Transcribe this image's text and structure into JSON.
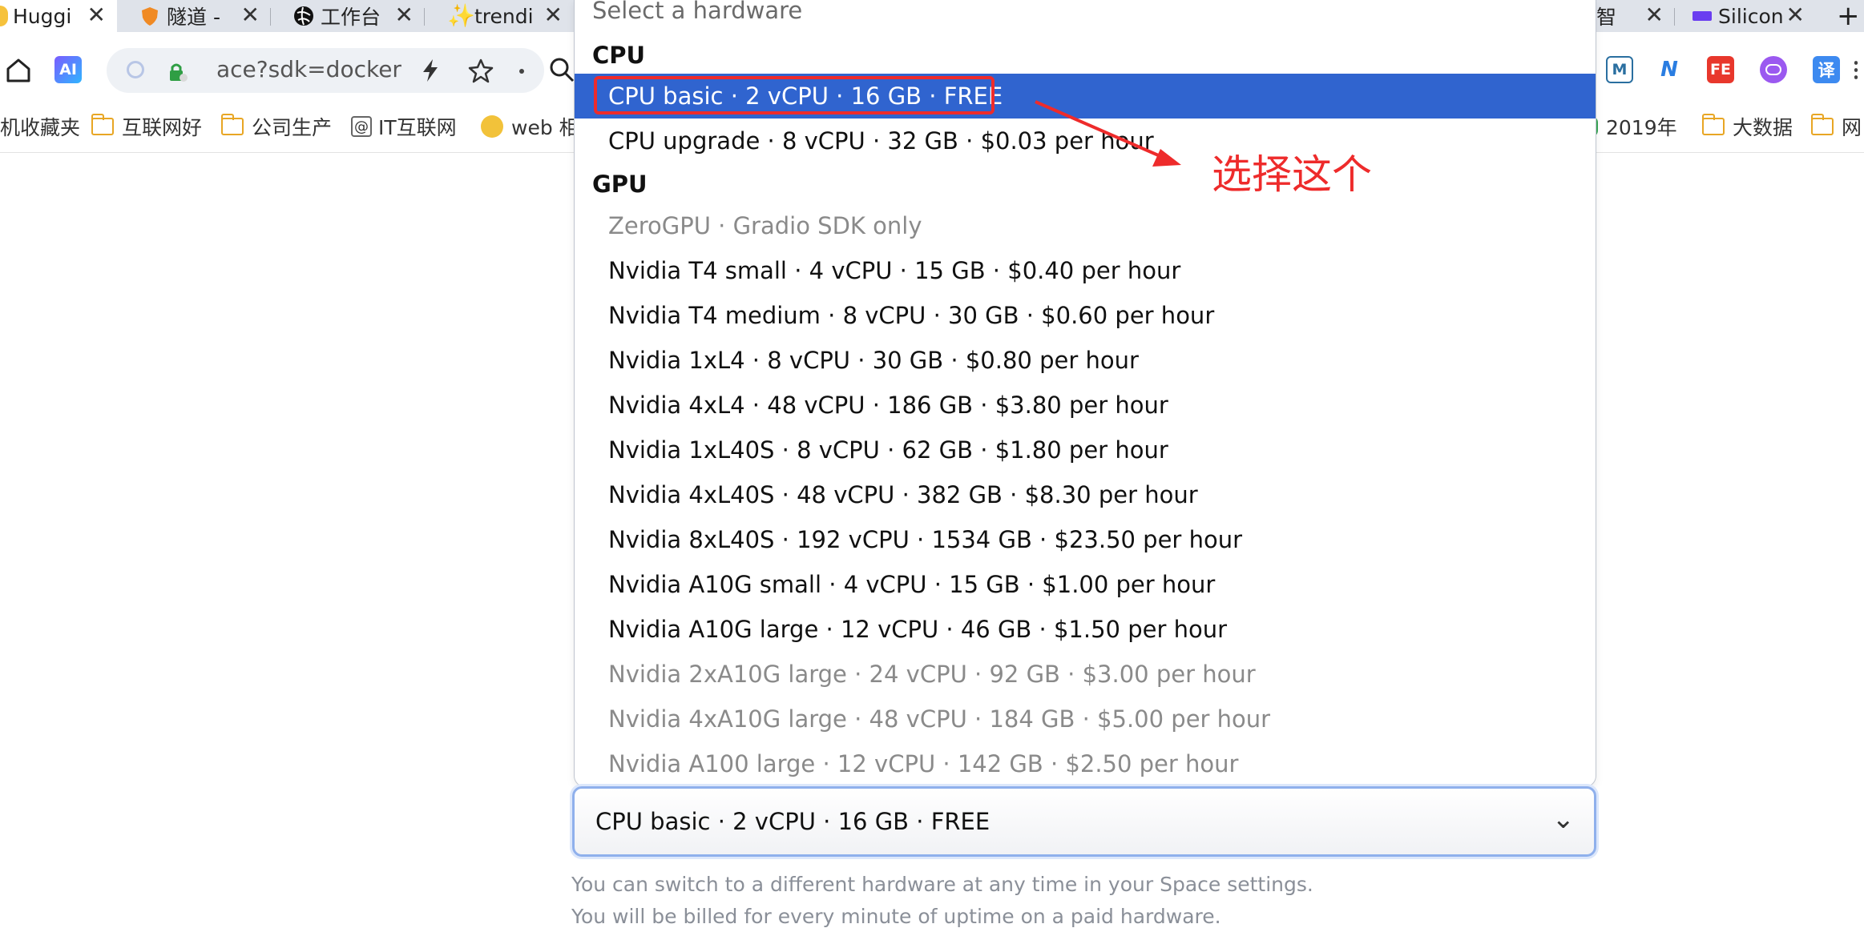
{
  "tabs": [
    {
      "label": "Huggi",
      "active": true
    },
    {
      "label": "隧道 -"
    },
    {
      "label": "工作台"
    },
    {
      "label": "trendi"
    },
    {
      "label": "智"
    },
    {
      "label": "Silicon"
    }
  ],
  "address": {
    "text": "ace?sdk=docker"
  },
  "toolbar_icons": {
    "ai": "AI",
    "m": "M",
    "n": "N",
    "fe": "FE",
    "translate": "译"
  },
  "bookmarks": [
    "机收藏夹",
    "互联网好",
    "公司生产",
    "IT互联网",
    "web 相",
    "2019年",
    "大数据",
    "网"
  ],
  "dropdown": {
    "placeholder": "Select a hardware",
    "groups": {
      "cpu": "CPU",
      "gpu": "GPU"
    },
    "options": [
      {
        "label": "CPU basic · 2 vCPU · 16 GB · FREE",
        "state": "selected"
      },
      {
        "label": "CPU upgrade · 8 vCPU · 32 GB · $0.03 per hour"
      },
      {
        "label": "ZeroGPU · Gradio SDK only",
        "state": "disabled"
      },
      {
        "label": "Nvidia T4 small · 4 vCPU · 15 GB · $0.40 per hour"
      },
      {
        "label": "Nvidia T4 medium · 8 vCPU · 30 GB · $0.60 per hour"
      },
      {
        "label": "Nvidia 1xL4 · 8 vCPU · 30 GB · $0.80 per hour"
      },
      {
        "label": "Nvidia 4xL4 · 48 vCPU · 186 GB · $3.80 per hour"
      },
      {
        "label": "Nvidia 1xL40S · 8 vCPU · 62 GB · $1.80 per hour"
      },
      {
        "label": "Nvidia 4xL40S · 48 vCPU · 382 GB · $8.30 per hour"
      },
      {
        "label": "Nvidia 8xL40S · 192 vCPU · 1534 GB · $23.50 per hour"
      },
      {
        "label": "Nvidia A10G small · 4 vCPU · 15 GB · $1.00 per hour"
      },
      {
        "label": "Nvidia A10G large · 12 vCPU · 46 GB · $1.50 per hour"
      },
      {
        "label": "Nvidia 2xA10G large · 24 vCPU · 92 GB · $3.00 per hour",
        "state": "disabled"
      },
      {
        "label": "Nvidia 4xA10G large · 48 vCPU · 184 GB · $5.00 per hour",
        "state": "disabled"
      },
      {
        "label": "Nvidia A100 large · 12 vCPU · 142 GB · $2.50 per hour",
        "state": "disabled"
      }
    ]
  },
  "select": {
    "value": "CPU basic · 2 vCPU · 16 GB · FREE"
  },
  "help": [
    "You can switch to a different hardware at any time in your Space settings.",
    "You will be billed for every minute of uptime on a paid hardware."
  ],
  "annotation": {
    "text": "选择这个",
    "color": "#ee2b2b"
  },
  "colors": {
    "selected_bg": "#3064cf",
    "focus_border": "#8fb0ec"
  }
}
